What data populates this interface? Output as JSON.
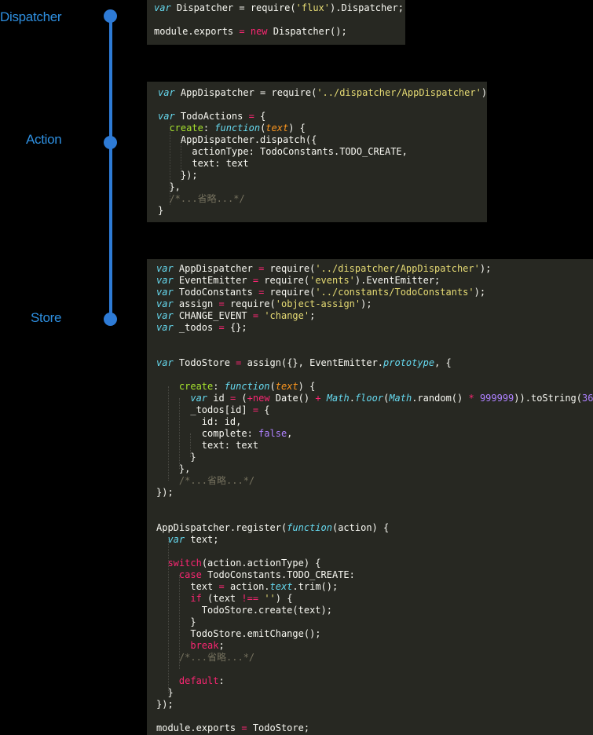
{
  "timeline": {
    "stages": [
      {
        "label": "Dispatcher"
      },
      {
        "label": "Action"
      },
      {
        "label": "Store"
      }
    ],
    "color": "#2e7bd6"
  },
  "editor_theme": {
    "background": "#272822",
    "foreground": "#f8f8f2",
    "keyword": "#f92672",
    "storage": "#66d9ef",
    "string": "#e6db74",
    "number": "#ae81ff",
    "function": "#a6e22e",
    "parameter": "#fd971f",
    "comment": "#75715e"
  },
  "code_panels": [
    {
      "name": "dispatcher",
      "lines": [
        [
          [
            "storage",
            "var"
          ],
          [
            "plain",
            " Dispatcher = require("
          ],
          [
            "string",
            "'flux'"
          ],
          [
            "plain",
            ").Dispatcher;"
          ]
        ],
        [],
        [
          [
            "plain",
            "module.exports "
          ],
          [
            "keyword",
            "="
          ],
          [
            "plain",
            " "
          ],
          [
            "keyword",
            "new"
          ],
          [
            "plain",
            " Dispatcher();"
          ]
        ]
      ]
    },
    {
      "name": "action",
      "lines": [
        [
          [
            "storage",
            "var"
          ],
          [
            "plain",
            " AppDispatcher = require("
          ],
          [
            "string",
            "'../dispatcher/AppDispatcher'"
          ],
          [
            "plain",
            ");"
          ]
        ],
        [],
        [
          [
            "storage",
            "var"
          ],
          [
            "plain",
            " TodoActions "
          ],
          [
            "keyword",
            "="
          ],
          [
            "plain",
            " {"
          ]
        ],
        [
          [
            "plain",
            "  "
          ],
          [
            "func",
            "create"
          ],
          [
            "plain",
            ": "
          ],
          [
            "storage",
            "function"
          ],
          [
            "plain",
            "("
          ],
          [
            "param",
            "text"
          ],
          [
            "plain",
            ") {"
          ]
        ],
        [
          [
            "plain",
            "    AppDispatcher.dispatch({"
          ]
        ],
        [
          [
            "plain",
            "      actionType: TodoConstants.TODO_CREATE,"
          ]
        ],
        [
          [
            "plain",
            "      text: text"
          ]
        ],
        [
          [
            "plain",
            "    });"
          ]
        ],
        [
          [
            "plain",
            "  },"
          ]
        ],
        [
          [
            "plain",
            "  "
          ],
          [
            "comment",
            "/*...省略...*/"
          ]
        ],
        [
          [
            "plain",
            "}"
          ]
        ]
      ]
    },
    {
      "name": "store",
      "lines": [
        [
          [
            "storage",
            "var"
          ],
          [
            "plain",
            " AppDispatcher "
          ],
          [
            "keyword",
            "="
          ],
          [
            "plain",
            " require("
          ],
          [
            "string",
            "'../dispatcher/AppDispatcher'"
          ],
          [
            "plain",
            ");"
          ]
        ],
        [
          [
            "storage",
            "var"
          ],
          [
            "plain",
            " EventEmitter "
          ],
          [
            "keyword",
            "="
          ],
          [
            "plain",
            " require("
          ],
          [
            "string",
            "'events'"
          ],
          [
            "plain",
            ").EventEmitter;"
          ]
        ],
        [
          [
            "storage",
            "var"
          ],
          [
            "plain",
            " TodoConstants "
          ],
          [
            "keyword",
            "="
          ],
          [
            "plain",
            " require("
          ],
          [
            "string",
            "'../constants/TodoConstants'"
          ],
          [
            "plain",
            ");"
          ]
        ],
        [
          [
            "storage",
            "var"
          ],
          [
            "plain",
            " assign "
          ],
          [
            "keyword",
            "="
          ],
          [
            "plain",
            " require("
          ],
          [
            "string",
            "'object-assign'"
          ],
          [
            "plain",
            ");"
          ]
        ],
        [
          [
            "storage",
            "var"
          ],
          [
            "plain",
            " CHANGE_EVENT "
          ],
          [
            "keyword",
            "="
          ],
          [
            "plain",
            " "
          ],
          [
            "string",
            "'change'"
          ],
          [
            "plain",
            ";"
          ]
        ],
        [
          [
            "storage",
            "var"
          ],
          [
            "plain",
            " _todos "
          ],
          [
            "keyword",
            "="
          ],
          [
            "plain",
            " {};"
          ]
        ],
        [],
        [],
        [
          [
            "storage",
            "var"
          ],
          [
            "plain",
            " TodoStore "
          ],
          [
            "keyword",
            "="
          ],
          [
            "plain",
            " assign({}, EventEmitter."
          ],
          [
            "storage",
            "prototype"
          ],
          [
            "plain",
            ", {"
          ]
        ],
        [],
        [
          [
            "plain",
            "    "
          ],
          [
            "func",
            "create"
          ],
          [
            "plain",
            ": "
          ],
          [
            "storage",
            "function"
          ],
          [
            "plain",
            "("
          ],
          [
            "param",
            "text"
          ],
          [
            "plain",
            ") {"
          ]
        ],
        [
          [
            "plain",
            "      "
          ],
          [
            "storage",
            "var"
          ],
          [
            "plain",
            " id "
          ],
          [
            "keyword",
            "="
          ],
          [
            "plain",
            " ("
          ],
          [
            "keyword",
            "+new"
          ],
          [
            "plain",
            " Date() "
          ],
          [
            "keyword",
            "+"
          ],
          [
            "plain",
            " "
          ],
          [
            "storage",
            "Math"
          ],
          [
            "plain",
            "."
          ],
          [
            "storage",
            "floor"
          ],
          [
            "plain",
            "("
          ],
          [
            "storage",
            "Math"
          ],
          [
            "plain",
            ".random() "
          ],
          [
            "keyword",
            "*"
          ],
          [
            "plain",
            " "
          ],
          [
            "number",
            "999999"
          ],
          [
            "plain",
            ")).toString("
          ],
          [
            "number",
            "36"
          ],
          [
            "plain",
            ");"
          ]
        ],
        [
          [
            "plain",
            "      _todos[id] "
          ],
          [
            "keyword",
            "="
          ],
          [
            "plain",
            " {"
          ]
        ],
        [
          [
            "plain",
            "        id: id,"
          ]
        ],
        [
          [
            "plain",
            "        complete: "
          ],
          [
            "number",
            "false"
          ],
          [
            "plain",
            ","
          ]
        ],
        [
          [
            "plain",
            "        text: text"
          ]
        ],
        [
          [
            "plain",
            "      }"
          ]
        ],
        [
          [
            "plain",
            "    },"
          ]
        ],
        [
          [
            "plain",
            "    "
          ],
          [
            "comment",
            "/*...省略...*/"
          ]
        ],
        [
          [
            "plain",
            "});"
          ]
        ],
        [],
        [],
        [
          [
            "plain",
            "AppDispatcher.register("
          ],
          [
            "storage",
            "function"
          ],
          [
            "plain",
            "(action) {"
          ]
        ],
        [
          [
            "plain",
            "  "
          ],
          [
            "storage",
            "var"
          ],
          [
            "plain",
            " text;"
          ]
        ],
        [],
        [
          [
            "plain",
            "  "
          ],
          [
            "keyword",
            "switch"
          ],
          [
            "plain",
            "(action.actionType) {"
          ]
        ],
        [
          [
            "plain",
            "    "
          ],
          [
            "keyword",
            "case"
          ],
          [
            "plain",
            " TodoConstants.TODO_CREATE:"
          ]
        ],
        [
          [
            "plain",
            "      text "
          ],
          [
            "keyword",
            "="
          ],
          [
            "plain",
            " action."
          ],
          [
            "storage",
            "text"
          ],
          [
            "plain",
            ".trim();"
          ]
        ],
        [
          [
            "plain",
            "      "
          ],
          [
            "keyword",
            "if"
          ],
          [
            "plain",
            " (text "
          ],
          [
            "keyword",
            "!=="
          ],
          [
            "plain",
            " "
          ],
          [
            "string",
            "''"
          ],
          [
            "plain",
            ") {"
          ]
        ],
        [
          [
            "plain",
            "        TodoStore.create(text);"
          ]
        ],
        [
          [
            "plain",
            "      }"
          ]
        ],
        [
          [
            "plain",
            "      TodoStore.emitChange();"
          ]
        ],
        [
          [
            "plain",
            "      "
          ],
          [
            "keyword",
            "break"
          ],
          [
            "plain",
            ";"
          ]
        ],
        [
          [
            "plain",
            "    "
          ],
          [
            "comment",
            "/*...省略...*/"
          ]
        ],
        [],
        [
          [
            "plain",
            "    "
          ],
          [
            "keyword",
            "default"
          ],
          [
            "plain",
            ":"
          ]
        ],
        [
          [
            "plain",
            "  }"
          ]
        ],
        [
          [
            "plain",
            "});"
          ]
        ],
        [],
        [
          [
            "plain",
            "module.exports "
          ],
          [
            "keyword",
            "="
          ],
          [
            "plain",
            " TodoStore;"
          ]
        ]
      ]
    }
  ]
}
